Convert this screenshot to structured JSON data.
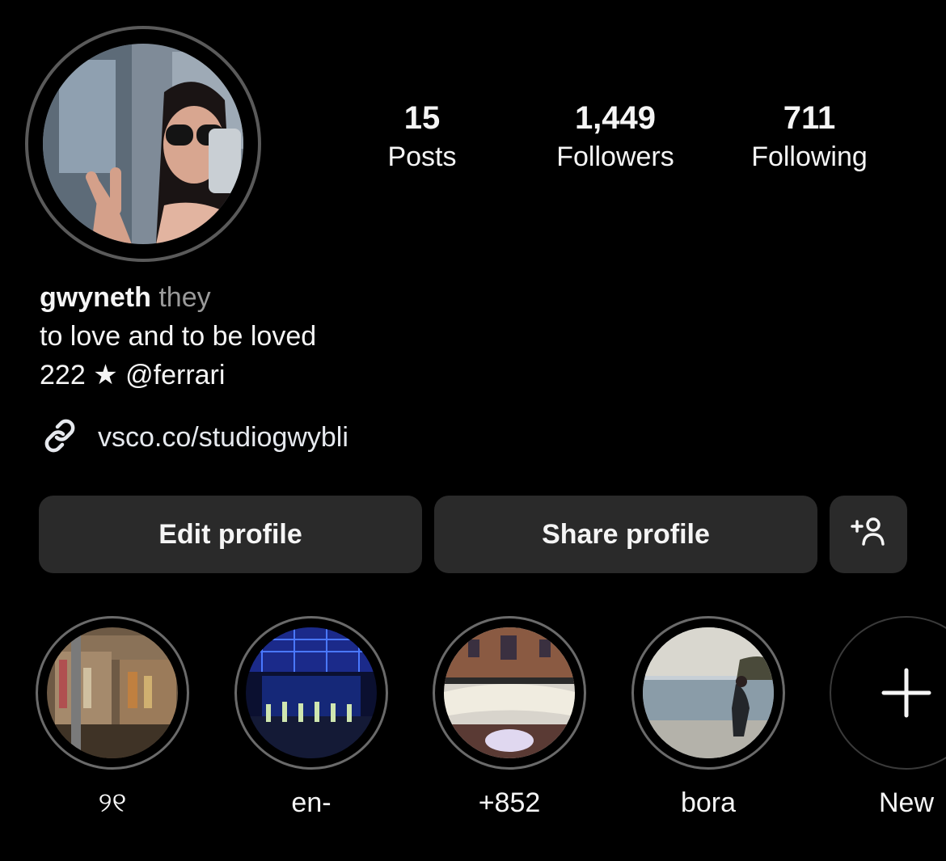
{
  "profile": {
    "stats": [
      {
        "value": "15",
        "label": "Posts"
      },
      {
        "value": "1,449",
        "label": "Followers"
      },
      {
        "value": "711",
        "label": "Following"
      }
    ],
    "name": "gwyneth",
    "pronouns": "they",
    "bio_line1": "to love and to be loved",
    "bio_line2_number": "222",
    "bio_line2_star": "★",
    "bio_line2_mention": "@ferrari",
    "link": "vsco.co/studiogwybli"
  },
  "actions": {
    "edit_label": "Edit profile",
    "share_label": "Share profile",
    "add_person_icon": "person-plus-icon"
  },
  "highlights": [
    {
      "label": "୨୧"
    },
    {
      "label": "en-"
    },
    {
      "label": "+852"
    },
    {
      "label": "bora"
    },
    {
      "label": "New"
    }
  ],
  "colors": {
    "background": "#000000",
    "button": "#2a2a2a",
    "muted_text": "#9a9a9a",
    "link_icon": "#e6e9ee"
  }
}
